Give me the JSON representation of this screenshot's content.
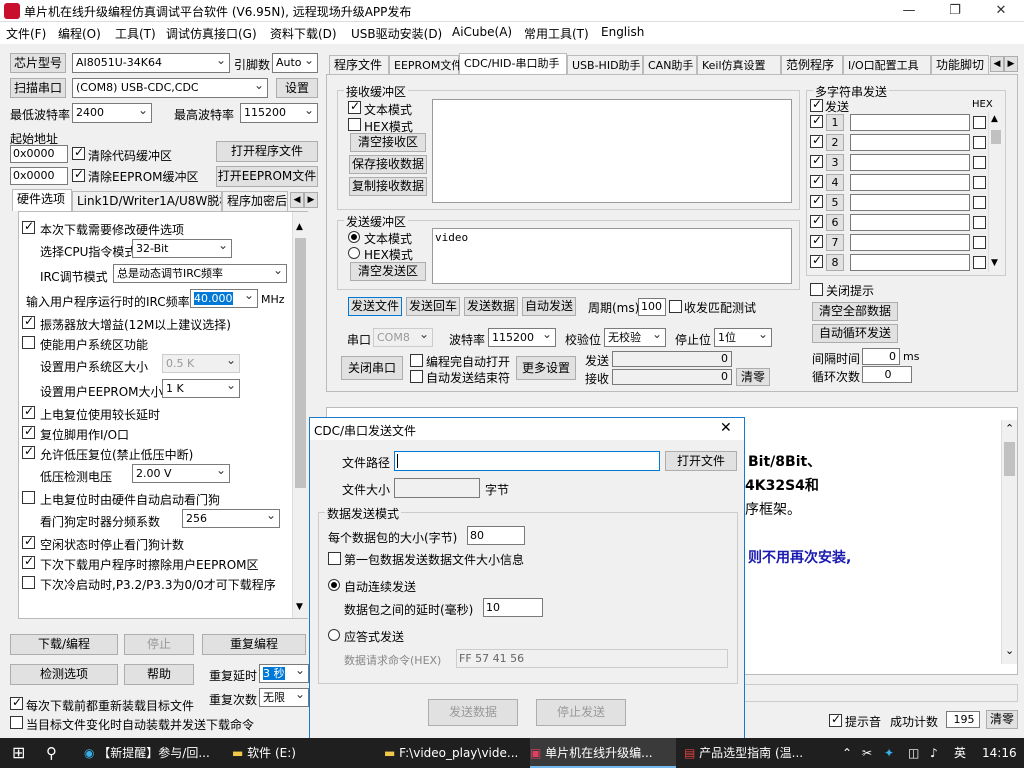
{
  "window": {
    "title": "单片机在线升级编程仿真调试平台软件 (V6.95N), 远程现场升级APP发布",
    "min": "—",
    "max": "❐",
    "close": "✕"
  },
  "menu": [
    "文件(F)",
    "编程(O)",
    "工具(T)",
    "调试仿真接口(G)",
    "资料下载(D)",
    "USB驱动安装(D)",
    "AiCube(A)",
    "常用工具(T)",
    "English"
  ],
  "left": {
    "chip_btn": "芯片型号",
    "chip_value": "AI8051U-34K64",
    "pin_label": "引脚数",
    "pin_value": "Auto",
    "scan_btn": "扫描串口",
    "port_value": "(COM8) USB-CDC,CDC",
    "settings_btn": "设置",
    "min_baud_label": "最低波特率",
    "min_baud": "2400",
    "max_baud_label": "最高波特率",
    "max_baud": "115200",
    "start_addr_label": "起始地址",
    "addr1": "0x0000",
    "clear_code": "清除代码缓冲区",
    "open_prog": "打开程序文件",
    "addr2": "0x0000",
    "clear_eeprom": "清除EEPROM缓冲区",
    "open_eeprom": "打开EEPROM文件",
    "tabs": [
      "硬件选项",
      "Link1D/Writer1A/U8W脱机",
      "程序加密后"
    ],
    "hw": {
      "modify_hw": "本次下载需要修改硬件选项",
      "cpu_mode_label": "选择CPU指令模式",
      "cpu_mode": "32-Bit",
      "irc_mode_label": "IRC调节模式",
      "irc_mode": "总是动态调节IRC频率",
      "irc_freq_label": "输入用户程序运行时的IRC频率",
      "irc_freq": "40.000",
      "irc_unit": "MHz",
      "osc_gain": "振荡器放大增益(12M以上建议选择)",
      "user_sys": "使能用户系统区功能",
      "sys_size_label": "设置用户系统区大小",
      "sys_size": "0.5 K",
      "eeprom_size_label": "设置用户EEPROM大小",
      "eeprom_size": "1  K",
      "long_delay": "上电复位使用较长延时",
      "reset_io": "复位脚用作I/O口",
      "lvd_reset": "允许低压复位(禁止低压中断)",
      "lvd_volt_label": "低压检测电压",
      "lvd_volt": "2.00 V",
      "wdt_auto": "上电复位时由硬件自动启动看门狗",
      "wdt_div_label": "看门狗定时器分频系数",
      "wdt_div": "256",
      "idle_wdt": "空闲状态时停止看门狗计数",
      "erase_eeprom": "下次下载用户程序时擦除用户EEPROM区",
      "p32p33": "下次冷启动时,P3.2/P3.3为0/0才可下载程序"
    },
    "download_btn": "下载/编程",
    "stop_btn": "停止",
    "reprogram_btn": "重复编程",
    "check_btn": "检测选项",
    "help_btn": "帮助",
    "repeat_delay_label": "重复延时",
    "repeat_delay": "3 秒",
    "repeat_count_label": "重复次数",
    "repeat_count": "无限",
    "reload_each": "每次下载前都重新装载目标文件",
    "auto_reload": "当目标文件变化时自动装载并发送下载命令"
  },
  "tabs": [
    "程序文件",
    "EEPROM文件",
    "CDC/HID-串口助手",
    "USB-HID助手",
    "CAN助手",
    "Keil仿真设置",
    "范例程序",
    "I/O口配置工具",
    "功能脚切"
  ],
  "recv": {
    "title": "接收缓冲区",
    "text_mode": "文本模式",
    "hex_mode": "HEX模式",
    "clear": "清空接收区",
    "save": "保存接收数据",
    "copy": "复制接收数据"
  },
  "send": {
    "title": "发送缓冲区",
    "text_mode": "文本模式",
    "hex_mode": "HEX模式",
    "clear": "清空发送区",
    "content": "video",
    "send_file": "发送文件",
    "send_enter": "发送回车",
    "send_data": "发送数据",
    "auto_send": "自动发送",
    "period_label": "周期(ms)",
    "period": "100",
    "match_test": "收发匹配测试"
  },
  "serial": {
    "port_label": "串口",
    "port": "COM8",
    "baud_label": "波特率",
    "baud": "115200",
    "parity_label": "校验位",
    "parity": "无校验",
    "stop_label": "停止位",
    "stop": "1位",
    "close_btn": "关闭串口",
    "auto_open": "编程完自动打开",
    "auto_end": "自动发送结束符",
    "more": "更多设置",
    "send_label": "发送",
    "send_count": "0",
    "recv_label": "接收",
    "recv_count": "0",
    "clear": "清零"
  },
  "multi": {
    "title": "多字符串发送",
    "send_col": "发送",
    "hex_col": "HEX",
    "rows": [
      "1",
      "2",
      "3",
      "4",
      "5",
      "6",
      "7",
      "8"
    ],
    "close_tip": "关闭提示",
    "clear_all": "清空全部数据",
    "auto_loop": "自动循环发送",
    "interval_label": "间隔时间",
    "interval": "0",
    "interval_unit": "ms",
    "loop_label": "循环次数",
    "loop": "0"
  },
  "bg_text": {
    "l1": "Bit/8Bit、",
    "l2": "4K32S4和",
    "l3": "序框架。",
    "l4": "则不用再次安装,"
  },
  "status": {
    "tip_sound": "提示音",
    "success_label": "成功计数",
    "success": "195",
    "clear": "清零"
  },
  "dialog": {
    "title": "CDC/串口发送文件",
    "path_label": "文件路径",
    "open_file": "打开文件",
    "size_label": "文件大小",
    "size_unit": "字节",
    "mode_title": "数据发送模式",
    "pkt_label": "每个数据包的大小(字节)",
    "pkt": "80",
    "first_pkt": "第一包数据发送数据文件大小信息",
    "auto_mode": "自动连续发送",
    "delay_label": "数据包之间的延时(毫秒)",
    "delay": "10",
    "ack_mode": "应答式发送",
    "req_label": "数据请求命令(HEX)",
    "req": "FF 57 41 56",
    "send_btn": "发送数据",
    "stop_btn": "停止发送"
  },
  "taskbar": {
    "items": [
      "【新提醒】参与/回...",
      "软件 (E:)",
      "F:\\video_play\\vide...",
      "单片机在线升级编...",
      "产品选型指南 (温..."
    ],
    "lang": "英",
    "time": "14:16"
  },
  "colors": {
    "accent": "#1979ca",
    "taskbar": "#1f1f1f"
  }
}
